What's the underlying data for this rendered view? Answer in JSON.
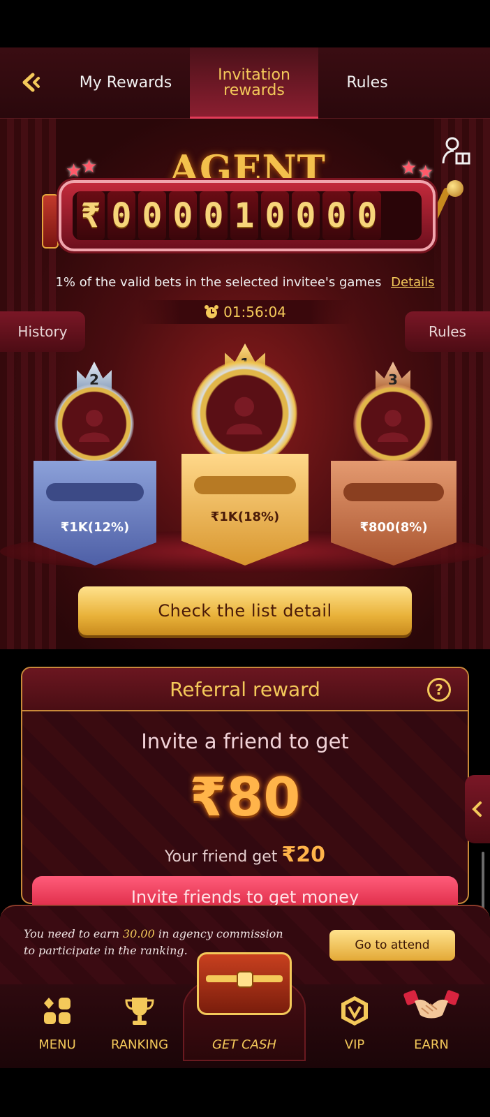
{
  "header": {
    "tabs": [
      {
        "label": "My Rewards"
      },
      {
        "label": "Invitation\nrewards",
        "line1": "Invitation",
        "line2": "rewards"
      },
      {
        "label": "Rules"
      }
    ]
  },
  "jackpot": {
    "title": "AGENT JACKPOT",
    "currency": "₹",
    "digits": [
      "0",
      "0",
      "0",
      "0",
      "1",
      "0",
      "0",
      "0",
      "0"
    ],
    "description": "1% of the valid bets in the selected invitee's games",
    "details_link": "Details",
    "timer": "01:56:04",
    "history_label": "History",
    "rules_label": "Rules",
    "ranks": [
      {
        "rank": "2",
        "value": "₹1K(12%)"
      },
      {
        "rank": "1",
        "value": "₹1K(18%)"
      },
      {
        "rank": "3",
        "value": "₹800(8%)"
      }
    ],
    "check_button": "Check the list detail"
  },
  "referral": {
    "title": "Referral reward",
    "invite_text": "Invite a friend to get",
    "amount": "₹80",
    "friend_text": "Your friend get",
    "friend_amount": "₹20",
    "invite_button": "Invite friends to get money"
  },
  "notice": {
    "text_before": "You need to earn ",
    "amount": "30.00",
    "text_after": " in agency commission to participate in the ranking.",
    "button": "Go to attend"
  },
  "nav": {
    "items": [
      {
        "label": "MENU",
        "icon": "menu-grid-icon"
      },
      {
        "label": "RANKING",
        "icon": "trophy-icon"
      },
      {
        "label": "GET CASH",
        "icon": "treasure-chest-icon"
      },
      {
        "label": "VIP",
        "icon": "vip-badge-icon"
      },
      {
        "label": "EARN",
        "icon": "handshake-icon"
      }
    ]
  },
  "colors": {
    "gold": "#f4c95a",
    "deep_red": "#2a0709",
    "accent_pink": "#e23b58"
  }
}
